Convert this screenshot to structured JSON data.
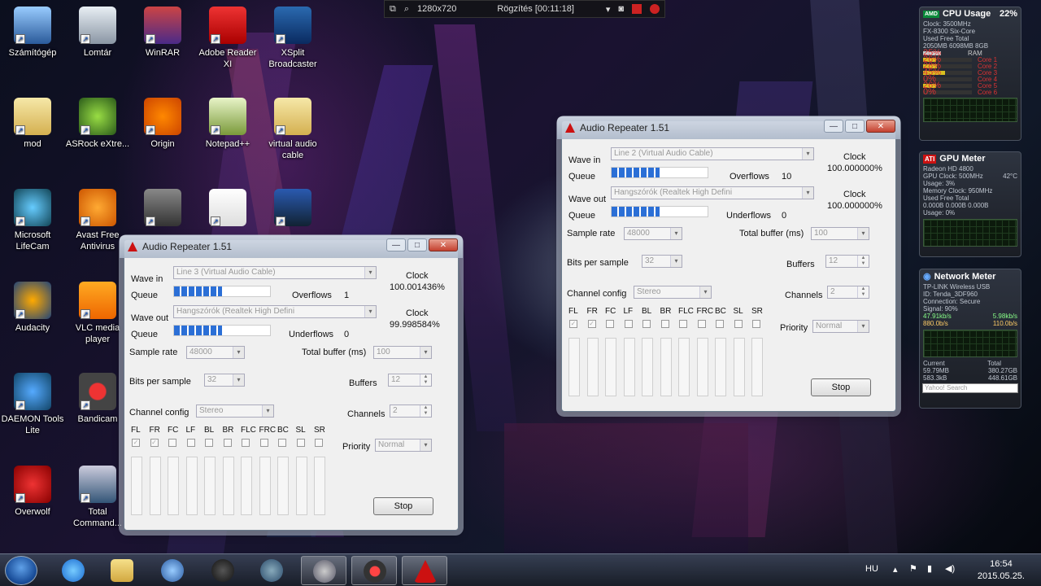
{
  "desktop_icons": [
    {
      "label": "Számítógép",
      "icon": "computer-icon"
    },
    {
      "label": "Lomtár",
      "icon": "recycle-bin-icon"
    },
    {
      "label": "WinRAR",
      "icon": "winrar-icon"
    },
    {
      "label": "Adobe Reader XI",
      "icon": "adobe-reader-icon"
    },
    {
      "label": "XSplit Broadcaster",
      "icon": "xsplit-icon"
    },
    {
      "label": "mod",
      "icon": "folder-icon"
    },
    {
      "label": "ASRock eXtre...",
      "icon": "asrock-icon"
    },
    {
      "label": "Origin",
      "icon": "origin-icon"
    },
    {
      "label": "Notepad++",
      "icon": "notepad-icon"
    },
    {
      "label": "virtual audio cable",
      "icon": "folder-icon"
    },
    {
      "label": "Microsoft LifeCam",
      "icon": "webcam-icon"
    },
    {
      "label": "Avast Free Antivirus",
      "icon": "avast-icon"
    },
    {
      "label": "",
      "icon": "server-icon"
    },
    {
      "label": "",
      "icon": "file-icon"
    },
    {
      "label": "",
      "icon": "audio-cable-icon"
    },
    {
      "label": "Audacity",
      "icon": "audacity-icon"
    },
    {
      "label": "VLC media player",
      "icon": "vlc-icon"
    },
    {
      "label": "DAEMON Tools Lite",
      "icon": "daemon-tools-icon"
    },
    {
      "label": "Bandicam",
      "icon": "bandicam-icon"
    },
    {
      "label": "Overwolf",
      "icon": "overwolf-icon"
    },
    {
      "label": "Total Command...",
      "icon": "total-commander-icon"
    }
  ],
  "recbar": {
    "resolution": "1280x720",
    "status": "Rögzítés [00:11:18]"
  },
  "gadgets": {
    "cpu": {
      "title": "CPU Usage",
      "percent": "22%",
      "clock": "Clock: 3500MHz",
      "model": "FX-8300 Six-Core",
      "ram_header": "Used      Free      Total",
      "ram_values": "2050MB   6098MB    8GB",
      "ram_label": "RAM",
      "ram_percent": "25%",
      "cores": [
        {
          "label": "Core 1",
          "value": "26%",
          "level": 0.26
        },
        {
          "label": "Core 2",
          "value": "28%",
          "level": 0.28
        },
        {
          "label": "Core 3",
          "value": "45%",
          "level": 0.45
        },
        {
          "label": "Core 4",
          "value": "0%",
          "level": 0.0
        },
        {
          "label": "Core 5",
          "value": "26%",
          "level": 0.26
        },
        {
          "label": "Core 6",
          "value": "0%",
          "level": 0.0
        }
      ]
    },
    "gpu": {
      "title": "GPU Meter",
      "model": "Radeon HD 4800",
      "clock": "GPU Clock: 500MHz",
      "temp": "42°C",
      "usage": "Usage: 3%",
      "mem_clock": "Memory Clock: 950MHz",
      "mem_header": "Used      Free      Total",
      "mem_values": "0.000B   0.000B    0.000B",
      "mem_usage": "Usage: 0%"
    },
    "network": {
      "title": "Network Meter",
      "adapter": "TP-LINK Wireless USB",
      "id": "ID: Tenda_3DF960",
      "connection": "Connection: Secure",
      "signal": "Signal: 90%",
      "down": "47.91kb/s",
      "up": "5.98kb/s",
      "down2": "880.0b/s",
      "up2": "110.0b/s",
      "current_label": "Current",
      "total_label": "Total",
      "current_down": "59.79MB",
      "total_down": "380.27GB",
      "current_up": "583.3kB",
      "total_up": "448.61GB",
      "search_placeholder": "Yahoo! Search"
    }
  },
  "windows": [
    {
      "title": "Audio Repeater 1.51",
      "wave_in_label": "Wave in",
      "wave_in": "Line 3 (Virtual Audio Cable)",
      "queue_label": "Queue",
      "queue1_level": 0.5,
      "overflows_label": "Overflows",
      "overflows": "1",
      "clock_label": "Clock",
      "clock1": "100.001436%",
      "wave_out_label": "Wave out",
      "wave_out": "Hangszórók (Realtek High Defini",
      "queue2_level": 0.5,
      "underflows_label": "Underflows",
      "underflows": "0",
      "clock2": "99.998584%",
      "sample_rate_label": "Sample rate",
      "sample_rate": "48000",
      "total_buffer_label": "Total buffer (ms)",
      "total_buffer": "100",
      "bits_label": "Bits per sample",
      "bits": "32",
      "buffers_label": "Buffers",
      "buffers": "12",
      "channel_config_label": "Channel config",
      "channel_config": "Stereo",
      "channels_label": "Channels",
      "channels": "2",
      "priority_label": "Priority",
      "priority": "Normal",
      "channel_names": [
        "FL",
        "FR",
        "FC",
        "LF",
        "BL",
        "BR",
        "FLC",
        "FRC",
        "BC",
        "SL",
        "SR"
      ],
      "channel_checked": [
        true,
        true,
        false,
        false,
        false,
        false,
        false,
        false,
        false,
        false,
        false
      ],
      "stop_label": "Stop"
    },
    {
      "title": "Audio Repeater 1.51",
      "wave_in_label": "Wave in",
      "wave_in": "Line 2 (Virtual Audio Cable)",
      "queue_label": "Queue",
      "queue1_level": 0.5,
      "overflows_label": "Overflows",
      "overflows": "10",
      "clock_label": "Clock",
      "clock1": "100.000000%",
      "wave_out_label": "Wave out",
      "wave_out": "Hangszórók (Realtek High Defini",
      "queue2_level": 0.5,
      "underflows_label": "Underflows",
      "underflows": "0",
      "clock2": "100.000000%",
      "sample_rate_label": "Sample rate",
      "sample_rate": "48000",
      "total_buffer_label": "Total buffer (ms)",
      "total_buffer": "100",
      "bits_label": "Bits per sample",
      "bits": "32",
      "buffers_label": "Buffers",
      "buffers": "12",
      "channel_config_label": "Channel config",
      "channel_config": "Stereo",
      "channels_label": "Channels",
      "channels": "2",
      "priority_label": "Priority",
      "priority": "Normal",
      "channel_names": [
        "FL",
        "FR",
        "FC",
        "LF",
        "BL",
        "BR",
        "FLC",
        "FRC",
        "BC",
        "SL",
        "SR"
      ],
      "channel_checked": [
        true,
        true,
        false,
        false,
        false,
        false,
        false,
        false,
        false,
        false,
        false
      ],
      "stop_label": "Stop"
    }
  ],
  "taskbar": {
    "items": [
      "start-icon",
      "internet-explorer-icon",
      "explorer-icon",
      "globe-icon",
      "obs-icon",
      "steam-icon",
      "cpu-gadget-icon",
      "bandicam-icon",
      "audio-repeater-icon"
    ],
    "lang": "HU",
    "time": "16:54",
    "date": "2015.05.25."
  },
  "colors": {
    "queue_fill": "#2b6fd6",
    "gadget_bar": "#d8c020",
    "close_red": "#c4402e"
  }
}
